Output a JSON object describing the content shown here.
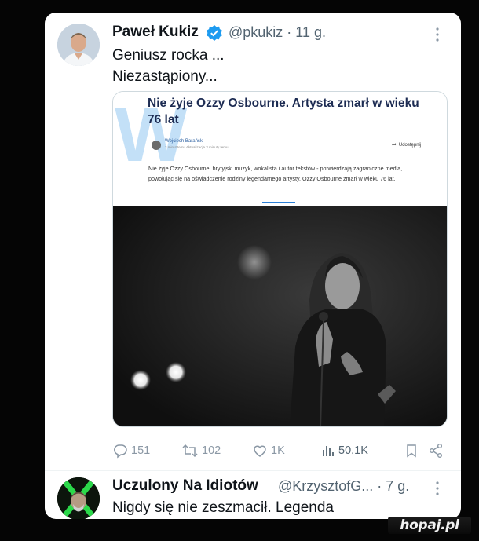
{
  "tweet": {
    "author_name": "Paweł Kukiz",
    "handle_time": "@pkukiz · 11 g.",
    "lines": [
      "Geniusz rocka ...",
      "Niezastąpiony..."
    ]
  },
  "embed": {
    "headline": "Nie żyje Ozzy Osbourne. Artysta zmarł w wieku 76 lat",
    "author": "Wojciech Barański",
    "meta": "3 minut temu Aktualizacja 3 minuty temu",
    "share_label": "Udostępnij",
    "lead": "Nie żyje Ozzy Osbourne, brytyjski muzyk, wokalista i autor tekstów - potwierdzają zagraniczne media, powołując się na oświadczenie rodziny legendarnego artysty. Ozzy Osbourne zmarł w wieku 76 lat."
  },
  "actions": {
    "replies": "151",
    "retweets": "102",
    "likes": "1K",
    "views": "50,1K"
  },
  "reply": {
    "author_name": "Uczulony Na Idiotów",
    "handle_time": "@KrzysztofG... · 7 g.",
    "text": "Nigdy się nie zeszmacił. Legenda"
  },
  "site_watermark": "hopaj.pl",
  "icons": [
    "verified-badge-icon",
    "more-icon",
    "reply-icon",
    "retweet-icon",
    "like-icon",
    "views-icon",
    "bookmark-icon",
    "share-icon"
  ],
  "colors": {
    "accent": "#1d9bf0",
    "muted": "#536471",
    "headline": "#1c2b52"
  }
}
